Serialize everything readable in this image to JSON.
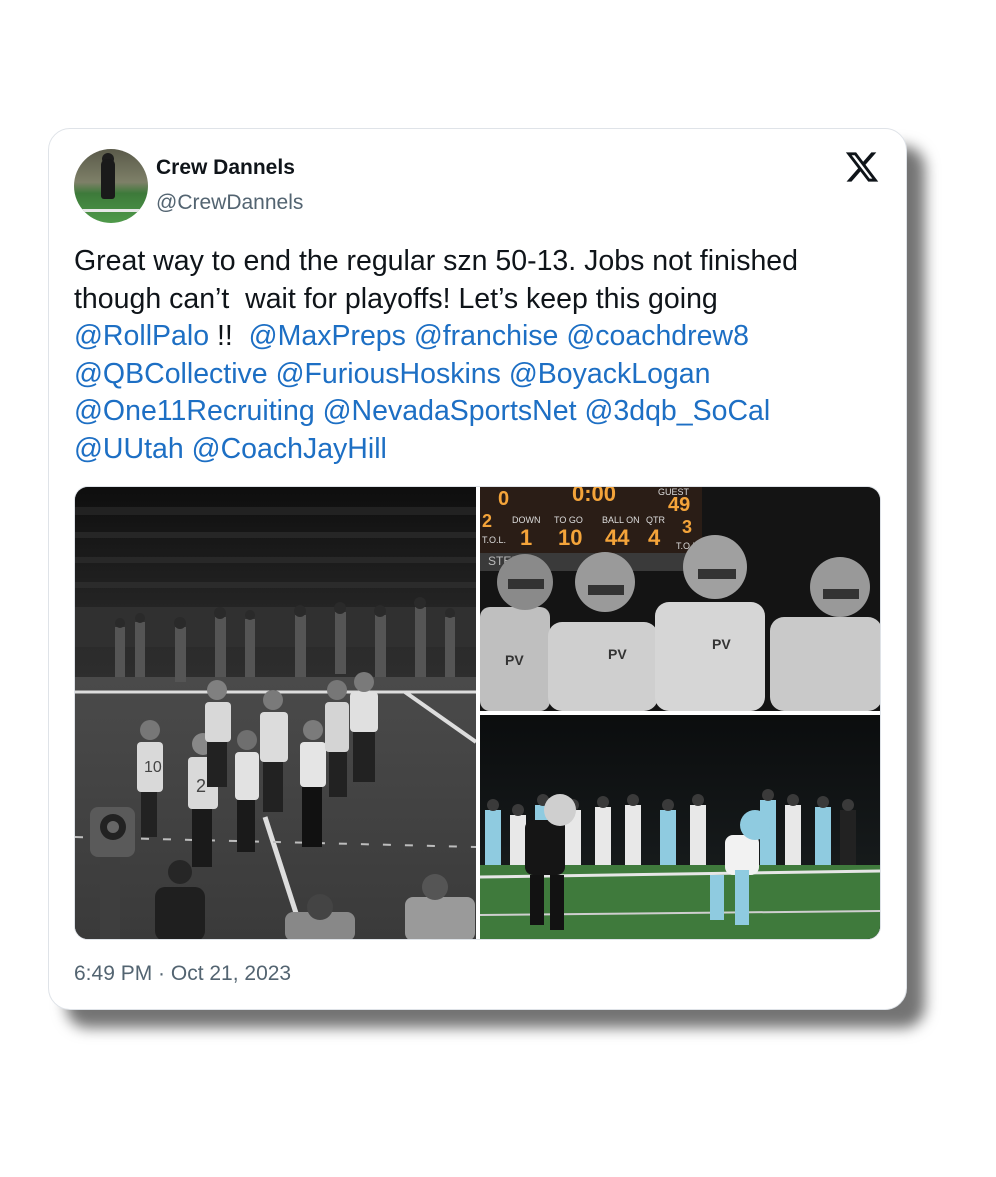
{
  "author": {
    "name": "Crew Dannels",
    "handle": "@CrewDannels"
  },
  "brand_icon": "x-logo-icon",
  "tweet": {
    "lines": [
      [
        {
          "text": "Great way to end the regular szn 50-13. Jobs not finished",
          "mention": false
        }
      ],
      [
        {
          "text": "though can’t  wait for playoffs! Let’s keep this going",
          "mention": false
        }
      ],
      [
        {
          "text": "@RollPalo",
          "mention": true
        },
        {
          "text": " !!  ",
          "mention": false
        },
        {
          "text": "@MaxPreps",
          "mention": true
        },
        {
          "text": " ",
          "mention": false
        },
        {
          "text": "@franchise",
          "mention": true
        },
        {
          "text": " ",
          "mention": false
        },
        {
          "text": "@coachdrew8",
          "mention": true
        }
      ],
      [
        {
          "text": "@QBCollective",
          "mention": true
        },
        {
          "text": " ",
          "mention": false
        },
        {
          "text": "@FuriousHoskins",
          "mention": true
        },
        {
          "text": " ",
          "mention": false
        },
        {
          "text": "@BoyackLogan",
          "mention": true
        }
      ],
      [
        {
          "text": "@One11Recruiting",
          "mention": true
        },
        {
          "text": " ",
          "mention": false
        },
        {
          "text": "@NevadaSportsNet",
          "mention": true
        },
        {
          "text": " ",
          "mention": false
        },
        {
          "text": "@3dqb_SoCal",
          "mention": true
        }
      ],
      [
        {
          "text": "@UUtah",
          "mention": true
        },
        {
          "text": " ",
          "mention": false
        },
        {
          "text": "@CoachJayHill",
          "mention": true
        }
      ]
    ]
  },
  "photos": {
    "scoreboard": {
      "home": "0",
      "clock": "0:00",
      "guest_label": "GUEST",
      "guest": "49",
      "quarter_left": "2",
      "down_label": "DOWN",
      "to_go_label": "TO GO",
      "ball_on_label": "BALL ON",
      "qtr_label": "QTR",
      "timeouts_right": "3",
      "tol_left": "T.O.L.",
      "tol_right": "T.O.L.",
      "down": "1",
      "to_go": "10",
      "ball_on": "44",
      "qtr": "4",
      "banner": "STEIN"
    },
    "jersey_letters": "PV",
    "left_jerseys": [
      "10",
      "2"
    ]
  },
  "timestamp": "6:49 PM · Oct 21, 2023",
  "colors": {
    "text": "#0f1419",
    "secondary": "#536471",
    "mention": "#1d6fc4",
    "card_border": "#dfe3e8"
  }
}
